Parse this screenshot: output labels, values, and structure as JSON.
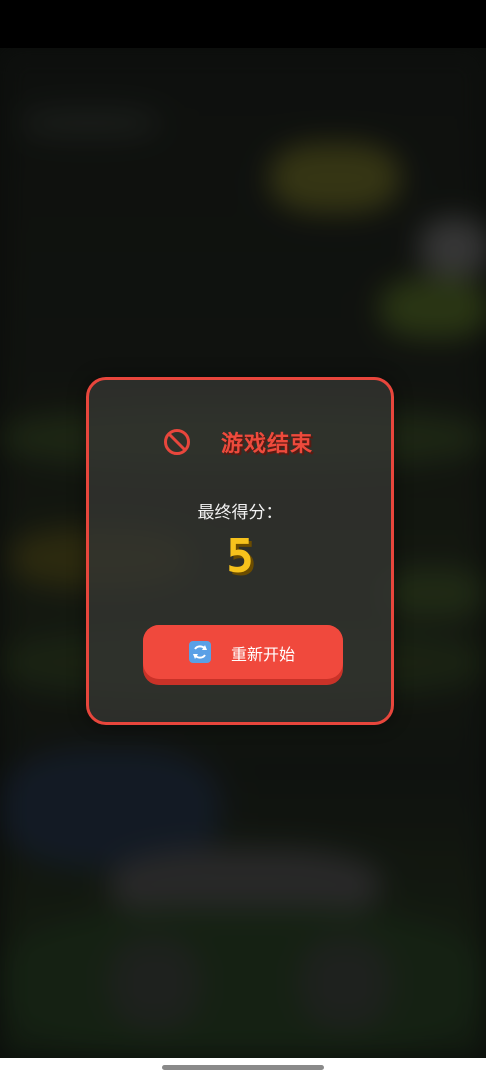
{
  "dialog": {
    "title": "游戏结束",
    "score_label": "最终得分：",
    "score_value": "5",
    "restart_label": "重新开始",
    "icons": {
      "title_icon": "ban-icon",
      "restart_icon": "refresh-icon"
    }
  },
  "colors": {
    "accent_red": "#ee4a3c",
    "score_yellow": "#f6c21c",
    "button_red": "#f0493d",
    "border_red": "#e8463c"
  }
}
